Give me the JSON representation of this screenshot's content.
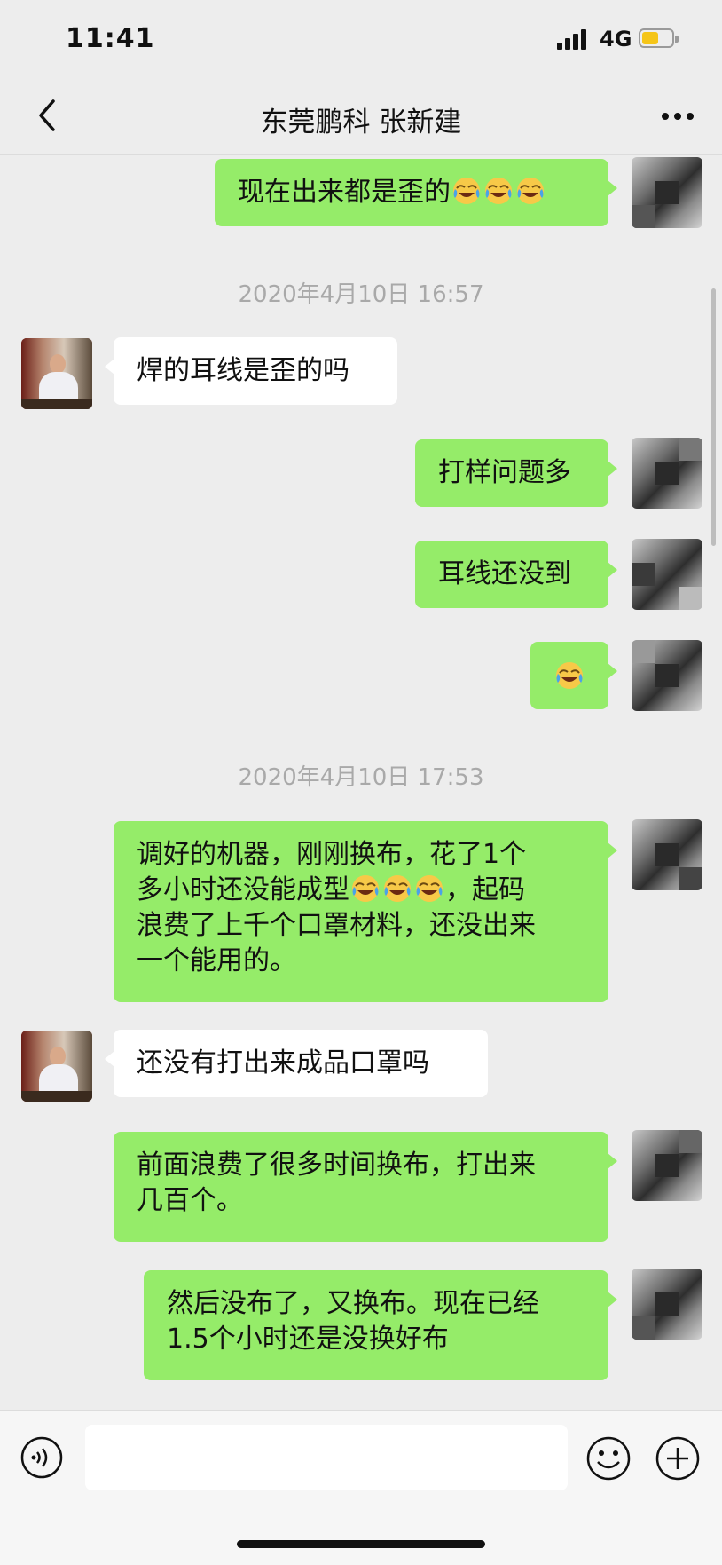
{
  "status": {
    "time": "11:41",
    "network": "4G"
  },
  "header": {
    "title": "东莞鹏科 张新建"
  },
  "messages": [
    {
      "text": "现在出来都是歪的"
    },
    {
      "timestamp": "2020年4月10日 16:57"
    },
    {
      "text": "焊的耳线是歪的吗"
    },
    {
      "text": "打样问题多"
    },
    {
      "text": "耳线还没到"
    },
    {
      "text": ""
    },
    {
      "timestamp": "2020年4月10日 17:53"
    },
    {
      "line1": "调好的机器，刚刚换布，花了1个",
      "line2a": "多小时还没能成型",
      "line2b": "，起码",
      "line3": "浪费了上千个口罩材料，还没出来",
      "line4": "一个能用的。"
    },
    {
      "text": "还没有打出来成品口罩吗"
    },
    {
      "line1": "前面浪费了很多时间换布，打出来",
      "line2": "几百个。"
    },
    {
      "line1": "然后没布了，又换布。现在已经",
      "line2": "1.5个小时还是没换好布"
    }
  ],
  "icons": {
    "emoji": "face-with-tears-of-joy",
    "colors": {
      "bubble_sent": "#95ec69",
      "bubble_received": "#ffffff",
      "background": "#ededed"
    }
  }
}
